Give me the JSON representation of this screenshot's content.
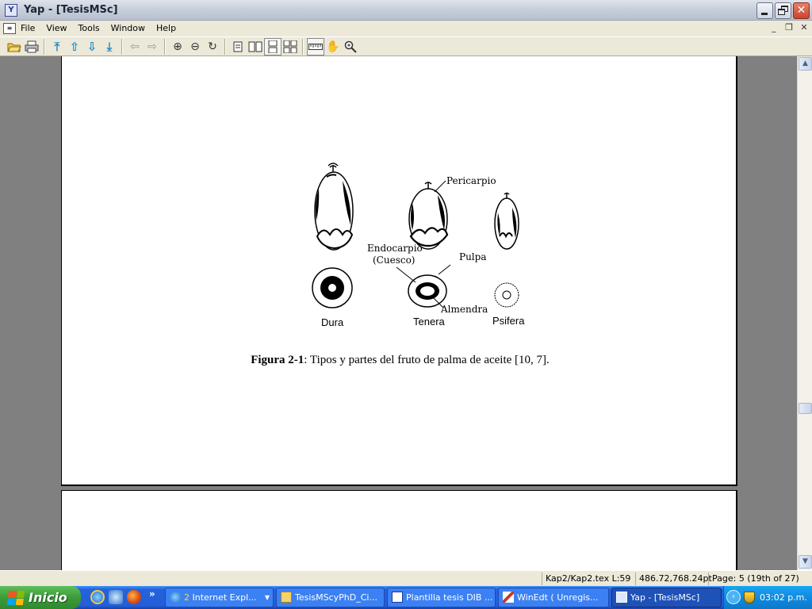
{
  "window": {
    "title": "Yap - [TesisMSc]",
    "app_icon": "yap-app-icon"
  },
  "menu": [
    "File",
    "View",
    "Tools",
    "Window",
    "Help"
  ],
  "toolbar_icons": [
    "open-folder-icon",
    "print-icon",
    "first-page-icon",
    "previous-page-icon",
    "next-page-icon",
    "last-page-icon",
    "back-icon",
    "forward-icon",
    "zoom-in-icon",
    "zoom-out-icon",
    "refresh-icon",
    "single-page-icon",
    "double-page-icon",
    "continuous-page-icon",
    "continuous-double-icon",
    "ruler-icon",
    "hand-tool-icon",
    "magnifier-icon"
  ],
  "figure": {
    "labels": {
      "pericarpio": "Pericarpio",
      "endocarpio": "Endocarpio",
      "cuesco": "(Cuesco)",
      "pulpa": "Pulpa",
      "almendra": "Almendra"
    },
    "types": [
      "Dura",
      "Tenera",
      "Psifera"
    ],
    "caption_bold": "Figura 2-1",
    "caption_text": ": Tipos y partes del fruto de palma de aceite [10, 7]."
  },
  "status": {
    "file": "Kap2/Kap2.tex L:59",
    "position": "486.72,768.24pt",
    "page": "Page: 5 (19th of 27)"
  },
  "taskbar": {
    "start": "Inicio",
    "ie_group_count": "2",
    "tasks": [
      {
        "label": "Internet Expl...",
        "icon": "internet-explorer-icon"
      },
      {
        "label": "TesisMScyPhD_Ci...",
        "icon": "folder-icon"
      },
      {
        "label": "Plantilla tesis DIB ...",
        "icon": "word-document-icon"
      },
      {
        "label": "WinEdt  ( Unregis...",
        "icon": "winedt-icon"
      },
      {
        "label": "Yap - [TesisMSc]",
        "icon": "yap-app-icon"
      }
    ],
    "clock": "03:02 p.m."
  }
}
